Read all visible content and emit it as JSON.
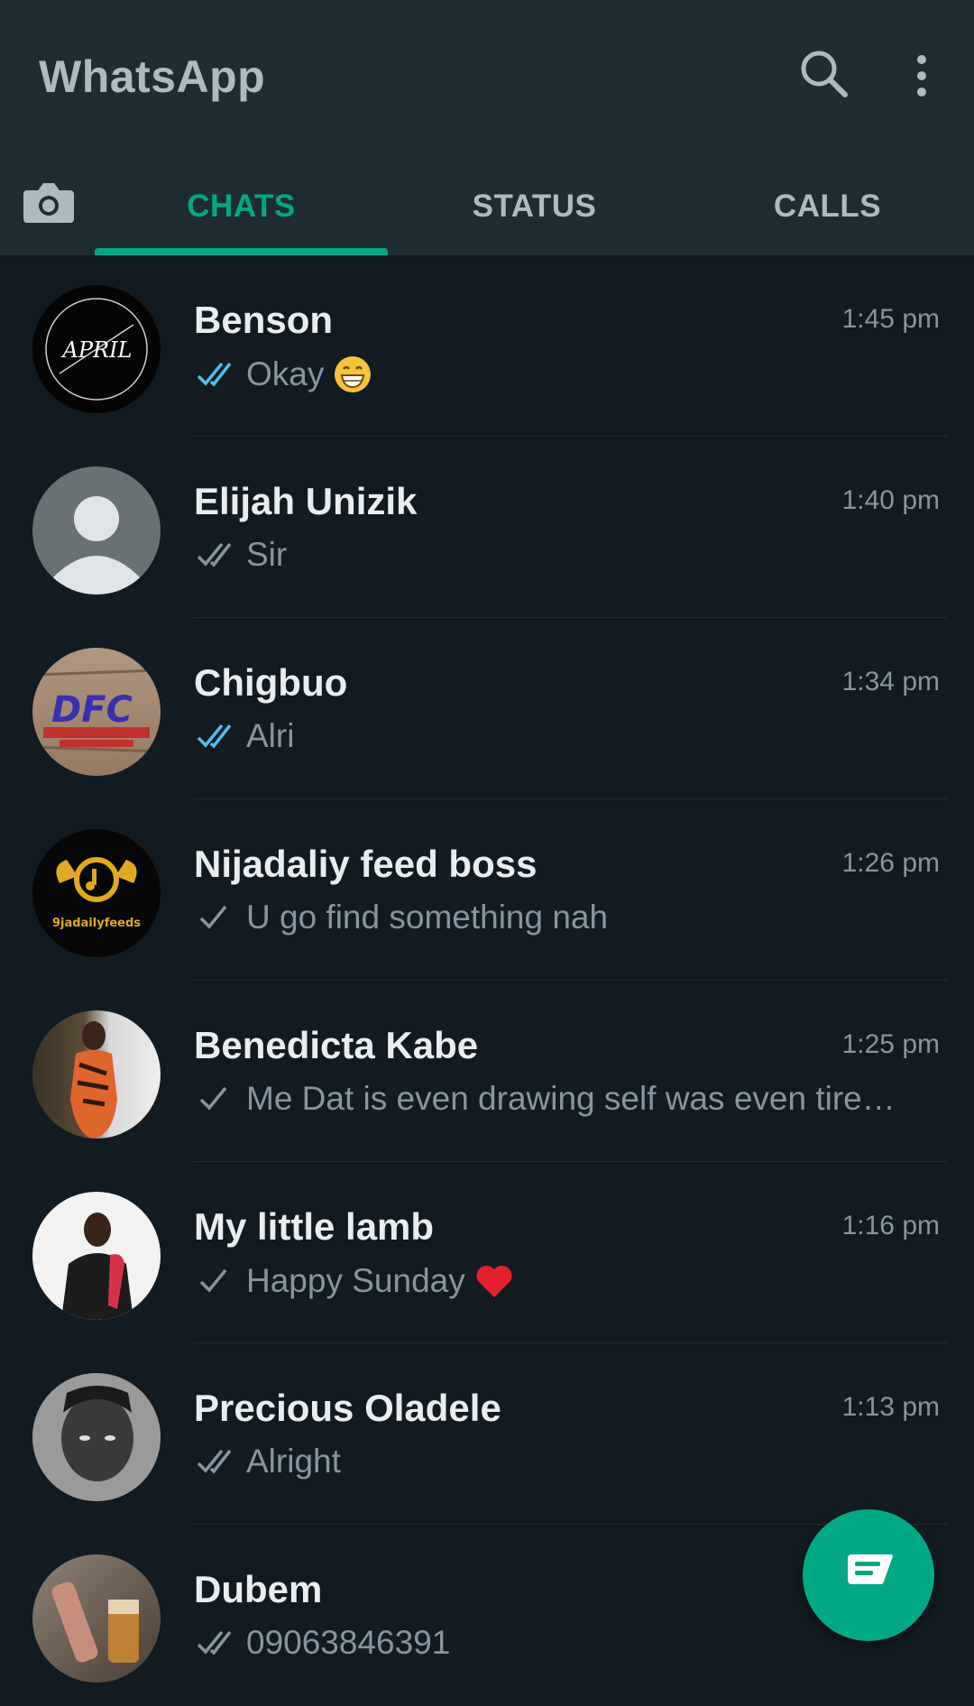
{
  "header": {
    "title": "WhatsApp",
    "icons": [
      "search-icon",
      "more-vert-icon"
    ]
  },
  "tabs": [
    {
      "label": "CHATS",
      "active": true
    },
    {
      "label": "STATUS",
      "active": false
    },
    {
      "label": "CALLS",
      "active": false
    }
  ],
  "chats": [
    {
      "name": "Benson",
      "time": "1:45 pm",
      "preview": "Okay",
      "tick": "double-read",
      "emoji": "grinning-face"
    },
    {
      "name": "Elijah Unizik",
      "time": "1:40 pm",
      "preview": "Sir",
      "tick": "double-delivered"
    },
    {
      "name": "Chigbuo",
      "time": "1:34 pm",
      "preview": "Alri",
      "tick": "double-read"
    },
    {
      "name": "Nijadaliy feed boss",
      "time": "1:26 pm",
      "preview": "U go find something nah",
      "tick": "single"
    },
    {
      "name": "Benedicta Kabe",
      "time": "1:25 pm",
      "preview": "Me Dat is even drawing self was even tire…",
      "tick": "single"
    },
    {
      "name": "My little lamb",
      "time": "1:16 pm",
      "preview": "Happy Sunday",
      "tick": "single",
      "emoji": "red-heart"
    },
    {
      "name": "Precious Oladele",
      "time": "1:13 pm",
      "preview": "Alright",
      "tick": "double-delivered"
    },
    {
      "name": "Dubem",
      "time": "",
      "preview": "09063846391",
      "tick": "double-delivered"
    }
  ],
  "avatar_text": {
    "benson": "APRIL",
    "chigbuo": "DFC",
    "nijadaliy": "9jadailyfeeds"
  },
  "colors": {
    "accent": "#00a884",
    "read_tick": "#53bdeb",
    "header_bg": "#1f2c34",
    "list_bg": "#121b22"
  }
}
